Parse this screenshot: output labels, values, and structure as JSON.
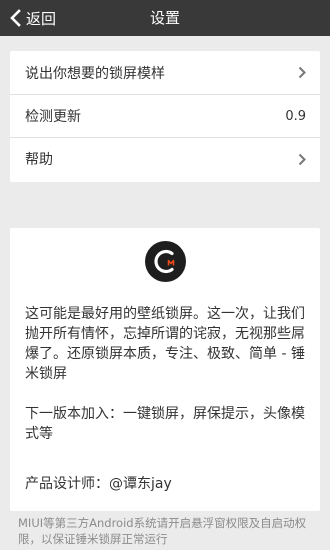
{
  "header": {
    "back_label": "返回",
    "title": "设置"
  },
  "menu": {
    "items": [
      {
        "label": "说出你想要的锁屏模样",
        "value": "",
        "icon": "chevron-right-icon"
      },
      {
        "label": "检测更新",
        "value": "0.9",
        "icon": ""
      },
      {
        "label": "帮助",
        "value": "",
        "icon": "chevron-right-icon"
      }
    ]
  },
  "about": {
    "logo_icon": "app-logo-icon",
    "paragraph1": "这可能是最好用的壁纸锁屏。这一次，让我们抛开所有情怀，忘掉所谓的诧寂，无视那些屌爆了。还原锁屏本质，专注、极致、简单 - 锤米锁屏",
    "paragraph2": "下一版本加入：一键锁屏，屏保提示，头像模式等",
    "designer": "产品设计师：@谭东jay"
  },
  "footer": {
    "note": "MIUI等第三方Android系统请开启悬浮窗权限及自启动权限，以保证锤米锁屏正常运行"
  },
  "colors": {
    "topbar": "#393939",
    "background": "#ebebeb",
    "card": "#ffffff",
    "logo_accent": "#e84a1c"
  }
}
